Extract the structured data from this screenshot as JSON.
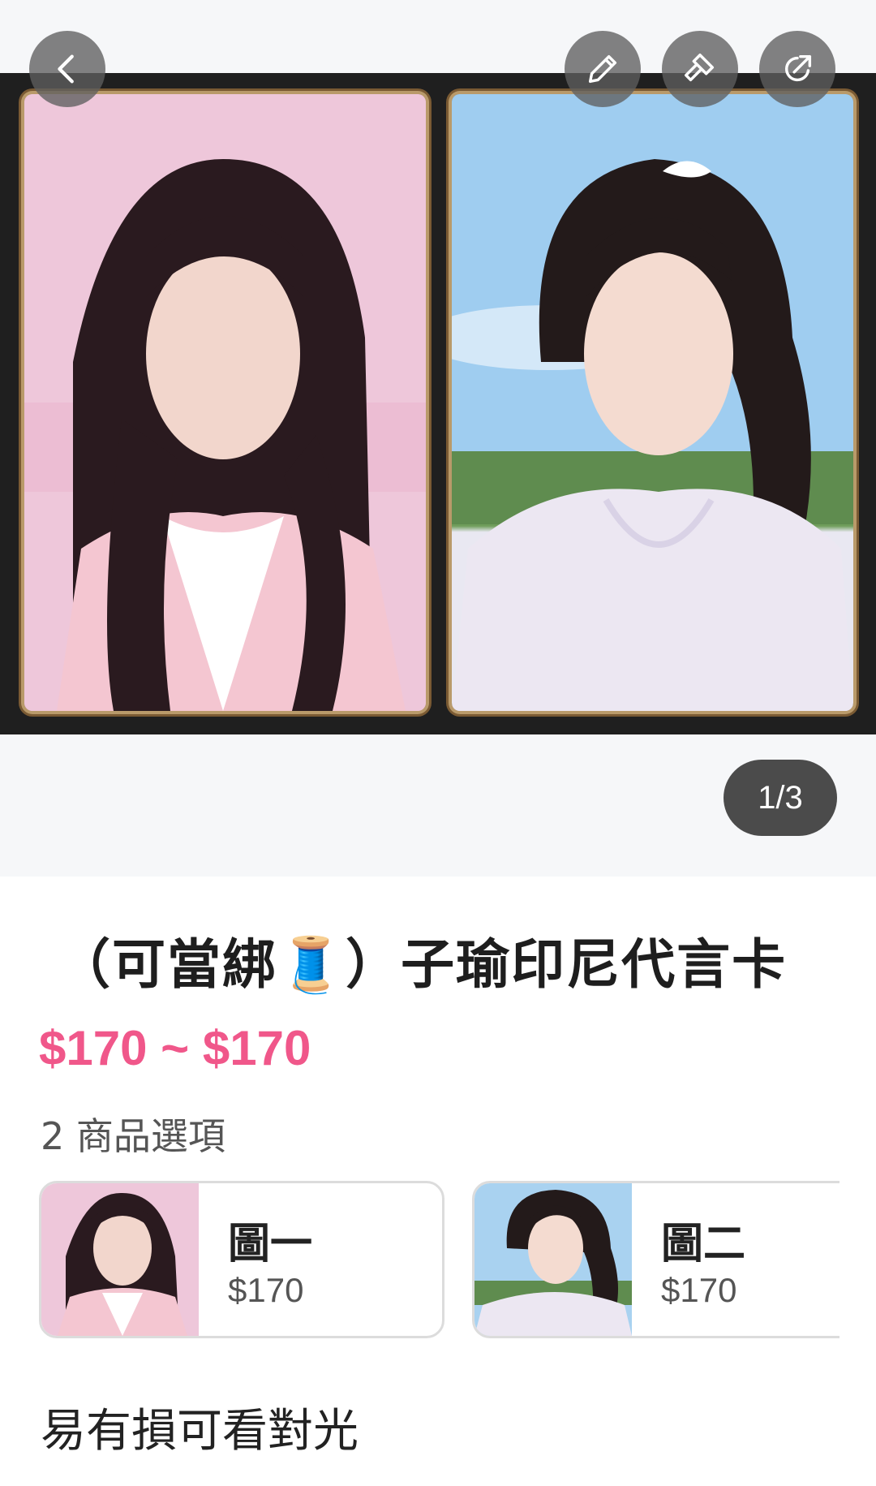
{
  "gallery": {
    "counter": "1/3",
    "photos": [
      {
        "name": "photocard-pink"
      },
      {
        "name": "photocard-sky"
      }
    ]
  },
  "toolbar": {
    "back_icon": "chevron-left-icon",
    "edit_icon": "pencil-icon",
    "bid_icon": "gavel-icon",
    "share_icon": "share-icon"
  },
  "product": {
    "title": "（可當綁🧵）子瑜印尼代言卡",
    "price": "$170 ~ $170",
    "options_count": "2 商品選項",
    "options": [
      {
        "name": "圖一",
        "price": "$170"
      },
      {
        "name": "圖二",
        "price": "$170"
      }
    ],
    "description": "易有損可看對光"
  },
  "colors": {
    "accent_price": "#f0578a",
    "overlay_button": "#5f5f5f",
    "counter_bg": "#4b4b4b"
  }
}
